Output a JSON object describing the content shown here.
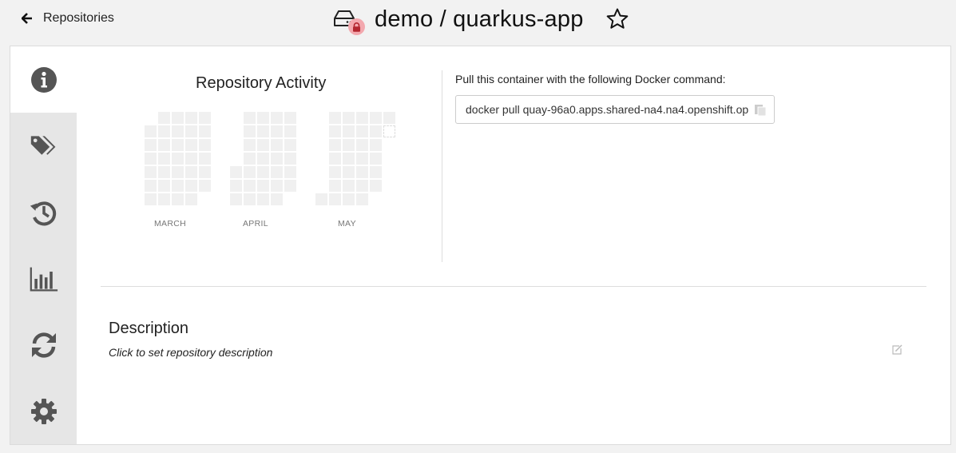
{
  "header": {
    "back_label": "Repositories",
    "repo_title": "demo / quarkus-app",
    "icons": {
      "back": "arrow-left-icon",
      "repo": "hdd-icon",
      "lock": "lock-icon",
      "star": "star-outline-icon"
    },
    "colors": {
      "lock_badge": "#f3a8ae",
      "lock": "#c0392b"
    }
  },
  "sidebar": {
    "items": [
      {
        "name": "info",
        "icon": "info-circle-icon",
        "active": true
      },
      {
        "name": "tags",
        "icon": "tags-icon",
        "active": false
      },
      {
        "name": "history",
        "icon": "history-icon",
        "active": false
      },
      {
        "name": "usage-logs",
        "icon": "bar-chart-icon",
        "active": false
      },
      {
        "name": "builds",
        "icon": "refresh-icon",
        "active": false
      },
      {
        "name": "settings",
        "icon": "gear-icon",
        "active": false
      }
    ]
  },
  "activity": {
    "title": "Repository Activity",
    "months": [
      "MARCH",
      "APRIL",
      "MAY"
    ]
  },
  "pull": {
    "label": "Pull this container with the following Docker command:",
    "command": "docker pull quay-96a0.apps.shared-na4.na4.openshift.op",
    "copy_icon": "copy-icon"
  },
  "description": {
    "title": "Description",
    "placeholder": "Click to set repository description",
    "edit_icon": "edit-icon"
  }
}
